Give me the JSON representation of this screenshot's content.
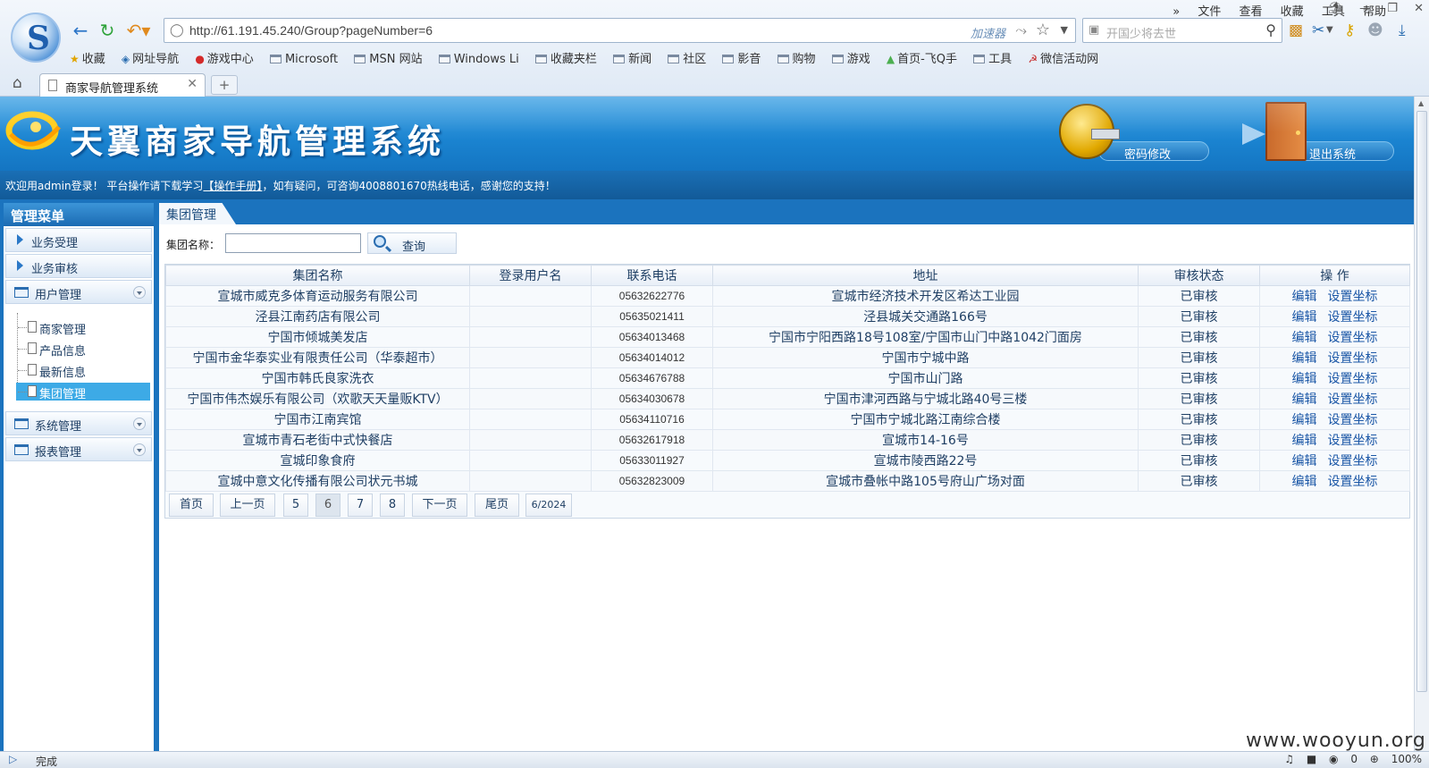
{
  "browser": {
    "url": "http://61.191.45.240/Group?pageNumber=6",
    "accelerator_label": "加速器",
    "search_placeholder": "开国少将去世",
    "menu": [
      "文件",
      "查看",
      "收藏",
      "工具",
      "帮助"
    ],
    "bookmarks": [
      "收藏",
      "网址导航",
      "游戏中心",
      "Microsoft",
      "MSN 网站",
      "Windows Li",
      "收藏夹栏",
      "新闻",
      "社区",
      "影音",
      "购物",
      "游戏",
      "首页-飞Q手",
      "工具",
      "微信活动网"
    ],
    "tab_title": "商家导航管理系统",
    "new_tab_label": "+",
    "status_text": "完成",
    "status_counter": "0",
    "zoom": "100%",
    "watermark": "www.wooyun.org"
  },
  "app": {
    "title": "天翼商家导航管理系统",
    "change_password_label": "密码修改",
    "logout_label": "退出系统",
    "welcome": {
      "prefix": "欢迎用admin登录！  平台操作请下载学习",
      "manual_link": "【操作手册】",
      "suffix": "，如有疑问，可咨询4008801670热线电话，感谢您的支持！"
    }
  },
  "sidebar": {
    "title": "管理菜单",
    "items": [
      "业务受理",
      "业务审核"
    ],
    "user_group": "用户管理",
    "user_sub": [
      "商家管理",
      "产品信息",
      "最新信息",
      "集团管理"
    ],
    "system_group": "系统管理",
    "report_group": "报表管理"
  },
  "main": {
    "tab_label": "集团管理",
    "search_label": "集团名称：",
    "search_value": "",
    "query_label": "查询",
    "columns": [
      "集团名称",
      "登录用户名",
      "联系电话",
      "地址",
      "审核状态",
      "操  作"
    ],
    "edit_label": "编辑",
    "set_coords_label": "设置坐标",
    "rows": [
      {
        "name": "宣城市威克多体育运动服务有限公司",
        "user": "",
        "phone": "05632622776",
        "address": "宣城市经济技术开发区希达工业园",
        "status": "已审核"
      },
      {
        "name": "泾县江南药店有限公司",
        "user": "",
        "phone": "05635021411",
        "address": "泾县城关交通路166号",
        "status": "已审核"
      },
      {
        "name": "宁国市倾城美发店",
        "user": "",
        "phone": "05634013468",
        "address": "宁国市宁阳西路18号108室/宁国市山门中路1042门面房",
        "status": "已审核"
      },
      {
        "name": "宁国市金华泰实业有限责任公司（华泰超市）",
        "user": "",
        "phone": "05634014012",
        "address": "宁国市宁城中路",
        "status": "已审核"
      },
      {
        "name": "宁国市韩氏良家洗衣",
        "user": "",
        "phone": "05634676788",
        "address": "宁国市山门路",
        "status": "已审核"
      },
      {
        "name": "宁国市伟杰娱乐有限公司（欢歌天天量贩KTV）",
        "user": "",
        "phone": "05634030678",
        "address": "宁国市津河西路与宁城北路40号三楼",
        "status": "已审核"
      },
      {
        "name": "宁国市江南宾馆",
        "user": "",
        "phone": "05634110716",
        "address": "宁国市宁城北路江南综合楼",
        "status": "已审核"
      },
      {
        "name": "宣城市青石老街中式快餐店",
        "user": "",
        "phone": "05632617918",
        "address": "宣城市14-16号",
        "status": "已审核"
      },
      {
        "name": "宣城印象食府",
        "user": "",
        "phone": "05633011927",
        "address": "宣城市陵西路22号",
        "status": "已审核"
      },
      {
        "name": "宣城中意文化传播有限公司状元书城",
        "user": "",
        "phone": "05632823009",
        "address": "宣城市叠帐中路105号府山广场对面",
        "status": "已审核"
      }
    ],
    "pager": {
      "first": "首页",
      "prev": "上一页",
      "pages": [
        "5",
        "6",
        "7",
        "8"
      ],
      "current": "6",
      "next": "下一页",
      "last": "尾页",
      "info": "6/2024"
    }
  }
}
